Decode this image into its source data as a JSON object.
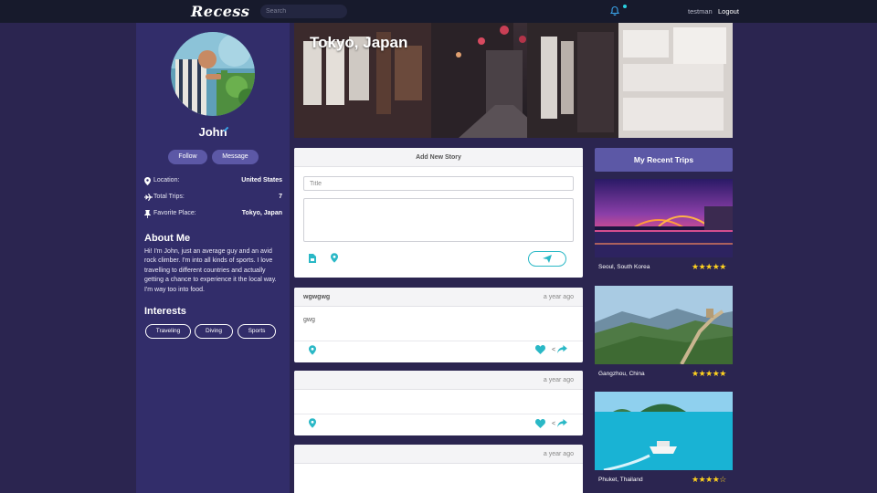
{
  "nav": {
    "brand": "Recess",
    "search_placeholder": "Search",
    "username": "testman",
    "logout": "Logout"
  },
  "profile": {
    "name": "John",
    "follow_label": "Follow",
    "message_label": "Message",
    "details": [
      {
        "icon": "map-marker-icon",
        "label": "Location:",
        "value": "United States"
      },
      {
        "icon": "plane-icon",
        "label": "Total Trips:",
        "value": "7"
      },
      {
        "icon": "pushpin-icon",
        "label": "Favorite Place:",
        "value": "Tokyo, Japan"
      }
    ],
    "about_heading": "About Me",
    "about_text": "Hi! I'm John, just an average guy and an avid rock climber. I'm into all kinds of sports. I love travelling to different countries and actually getting a chance to experience it the local way. I'm way too into food.",
    "interests_heading": "Interests",
    "interests": [
      "Traveling",
      "Diving",
      "Sports"
    ]
  },
  "hero": {
    "title": "Tokyo, Japan"
  },
  "new_story": {
    "heading": "Add New Story",
    "title_placeholder": "Title"
  },
  "posts": [
    {
      "user": "wgwgwg",
      "time": "a year ago",
      "body": "gwg",
      "share_count": "<"
    },
    {
      "user": "",
      "time": "a year ago",
      "body": "",
      "share_count": "<"
    },
    {
      "user": "",
      "time": "a year ago",
      "body": ""
    }
  ],
  "recent_trips": {
    "heading": "My Recent Trips",
    "trips": [
      {
        "place": "Seoul, South Korea",
        "rating": 5,
        "stars": "★★★★★"
      },
      {
        "place": "Gangzhou, China",
        "rating": 5,
        "stars": "★★★★★"
      },
      {
        "place": "Phuket, Thailand",
        "rating": 4,
        "stars": "★★★★☆"
      }
    ]
  },
  "colors": {
    "page_bg": "#2b2550",
    "panel_bg": "#322d6a",
    "button_purple": "#5c58a6",
    "accent_teal": "#2ab8c6",
    "star_yellow": "#ffd21f"
  }
}
